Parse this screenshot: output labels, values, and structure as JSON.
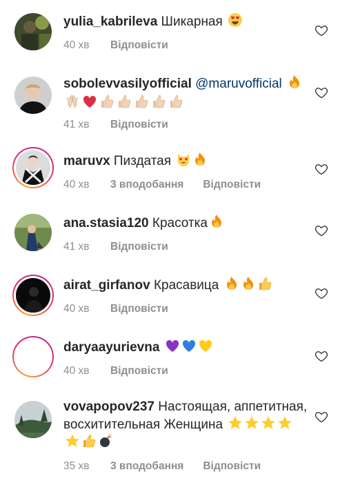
{
  "comments": [
    {
      "username": "yulia_kabrileva",
      "text": "Шикарная",
      "emoji": "😍",
      "time": "40 хв",
      "likes": "",
      "reply": "Відповісти"
    },
    {
      "username": "sobolevvasilyofficial",
      "mention": "@maruvofficial",
      "emoji_line1": "🔥",
      "emoji_line2": "🙏🏻❤️👍🏻👍🏻👍🏻👍🏻👍🏻",
      "time": "41 хв",
      "likes": "",
      "reply": "Відповісти"
    },
    {
      "username": "maruvx",
      "text": "Пиздатая",
      "emoji": "😻🔥",
      "time": "40 хв",
      "likes": "3 вподобання",
      "reply": "Відповісти"
    },
    {
      "username": "ana.stasia120",
      "text": "Красотка",
      "emoji": "🔥",
      "time": "41 хв",
      "likes": "",
      "reply": "Відповісти"
    },
    {
      "username": "airat_girfanov",
      "text": "Красавица",
      "emoji": "🔥🔥👍",
      "time": "40 хв",
      "likes": "",
      "reply": "Відповісти"
    },
    {
      "username": "daryaayurievna",
      "text": "",
      "emoji": "💜💙💛",
      "time": "40 хв",
      "likes": "",
      "reply": "Відповісти"
    },
    {
      "username": "vovapopov237",
      "text": "Настоящая, аппетитная, восхитительная Женщина",
      "emoji": "⭐️⭐️⭐️⭐️⭐️👍💣",
      "time": "35 хв",
      "likes": "3 вподобання",
      "reply": "Відповісти"
    }
  ],
  "icons": {
    "like": "heart-outline-icon"
  },
  "colors": {
    "link": "#00376b",
    "muted": "#8e8e8e",
    "text": "#262626"
  }
}
